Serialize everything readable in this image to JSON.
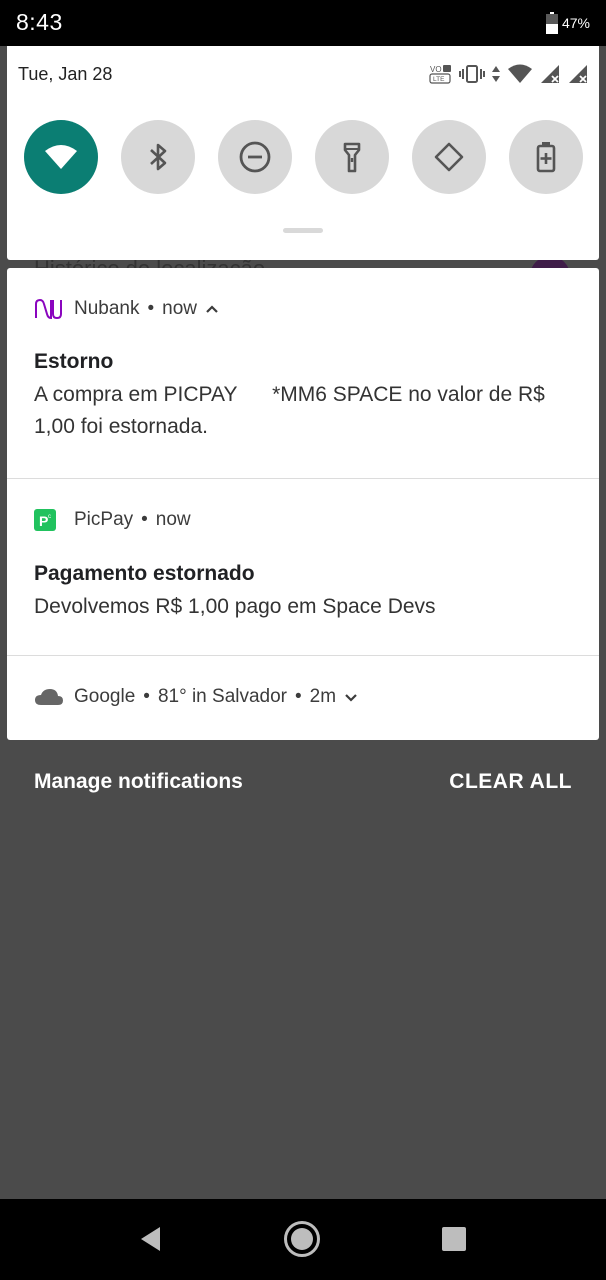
{
  "status_bar": {
    "time": "8:43",
    "battery_percent": "47%"
  },
  "quick_settings": {
    "date": "Tue, Jan 28",
    "status_icons": [
      "volte-icon",
      "vibrate-icon",
      "data-arrows-icon",
      "wifi-icon",
      "signal-icon",
      "signal-icon"
    ],
    "tiles": [
      {
        "name": "wifi",
        "active": true
      },
      {
        "name": "bluetooth",
        "active": false
      },
      {
        "name": "do-not-disturb",
        "active": false
      },
      {
        "name": "flashlight",
        "active": false
      },
      {
        "name": "auto-rotate",
        "active": false
      },
      {
        "name": "battery-saver",
        "active": false
      }
    ],
    "active_color": "#0b7e73"
  },
  "background_text": "Histórico de localização",
  "notifications": [
    {
      "app": "Nubank",
      "time": "now",
      "title": "Estorno",
      "body": "A compra em PICPAY      *MM6 SPACE no valor de R$ 1,00 foi estornada.",
      "icon": "nubank-logo-icon",
      "color": "#8a05be"
    },
    {
      "app": "PicPay",
      "time": "now",
      "title": "Pagamento estornado",
      "body": "Devolvemos R$ 1,00 pago em Space Devs",
      "icon": "picpay-logo-icon",
      "color": "#21c25e"
    },
    {
      "app": "Google",
      "detail": "81° in Salvador",
      "time": "2m",
      "icon": "cloud-icon"
    }
  ],
  "footer": {
    "manage_label": "Manage notifications",
    "clear_label": "CLEAR ALL"
  }
}
